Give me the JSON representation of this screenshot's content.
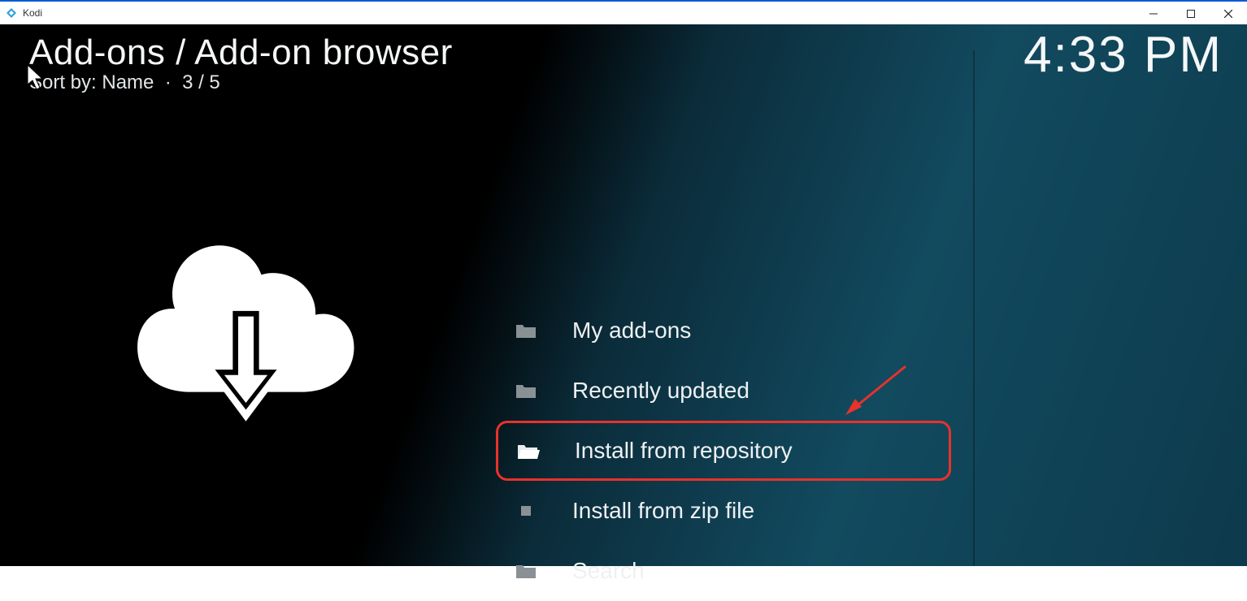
{
  "window": {
    "title": "Kodi"
  },
  "header": {
    "breadcrumb": "Add-ons / Add-on browser",
    "sort_label": "Sort by: Name",
    "separator": "·",
    "position": "3 / 5",
    "clock": "4:33 PM"
  },
  "menu": {
    "items": [
      {
        "icon": "folder-icon",
        "label": "My add-ons",
        "highlighted": false
      },
      {
        "icon": "folder-icon",
        "label": "Recently updated",
        "highlighted": false
      },
      {
        "icon": "folder-open-icon",
        "label": "Install from repository",
        "highlighted": true
      },
      {
        "icon": "file-icon",
        "label": "Install from zip file",
        "highlighted": false
      },
      {
        "icon": "folder-icon",
        "label": "Search",
        "highlighted": false
      }
    ]
  },
  "annotation": {
    "highlight_color": "#e8322a"
  }
}
